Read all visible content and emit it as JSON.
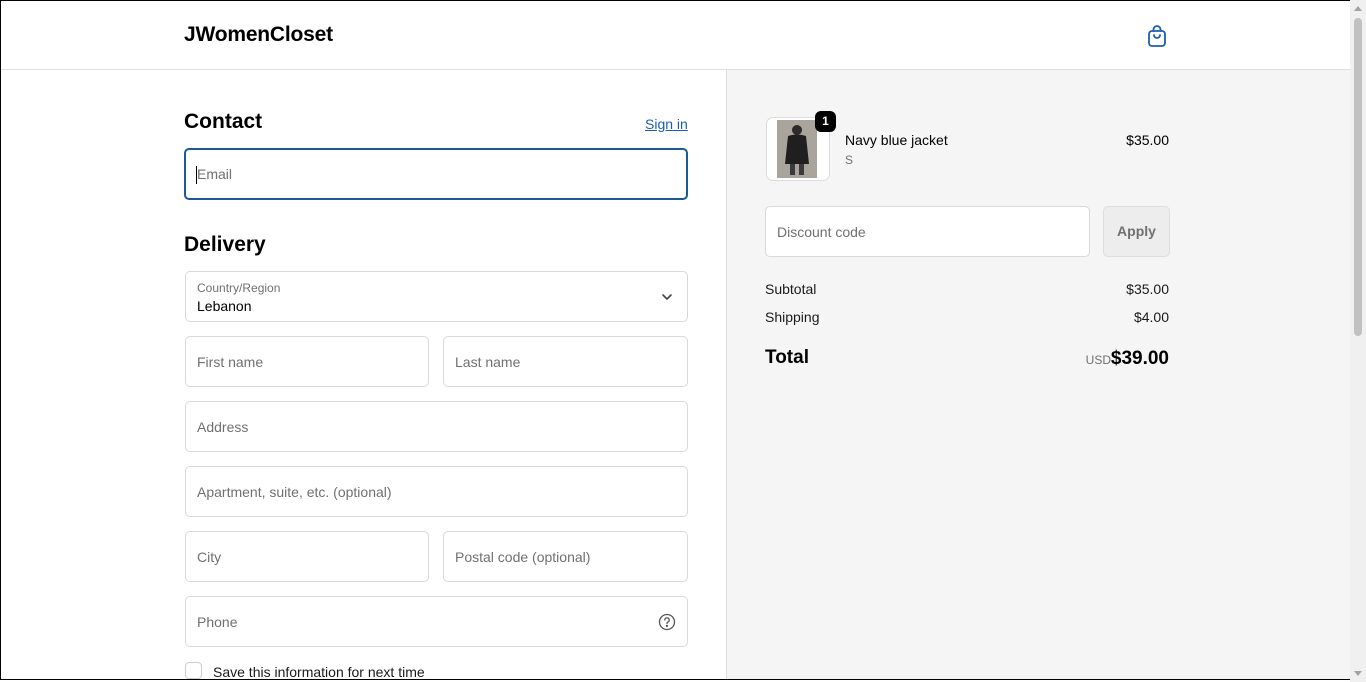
{
  "header": {
    "brand": "JWomenCloset",
    "cart_icon": "shopping-bag-icon"
  },
  "contact": {
    "title": "Contact",
    "signin_label": "Sign in",
    "email_placeholder": "Email"
  },
  "delivery": {
    "title": "Delivery",
    "country_label": "Country/Region",
    "country_value": "Lebanon",
    "first_name_placeholder": "First name",
    "last_name_placeholder": "Last name",
    "address_placeholder": "Address",
    "apartment_placeholder": "Apartment, suite, etc. (optional)",
    "city_placeholder": "City",
    "postal_placeholder": "Postal code (optional)",
    "phone_placeholder": "Phone",
    "save_info_label": "Save this information for next time"
  },
  "summary": {
    "item": {
      "quantity": "1",
      "name": "Navy blue jacket",
      "variant": "S",
      "price": "$35.00"
    },
    "discount_placeholder": "Discount code",
    "apply_label": "Apply",
    "subtotal_label": "Subtotal",
    "subtotal_value": "$35.00",
    "shipping_label": "Shipping",
    "shipping_value": "$4.00",
    "total_label": "Total",
    "total_currency": "USD",
    "total_value": "$39.00"
  },
  "colors": {
    "accent": "#1a5a96",
    "link": "#1a5fb4",
    "summary_bg": "#f5f5f5"
  }
}
